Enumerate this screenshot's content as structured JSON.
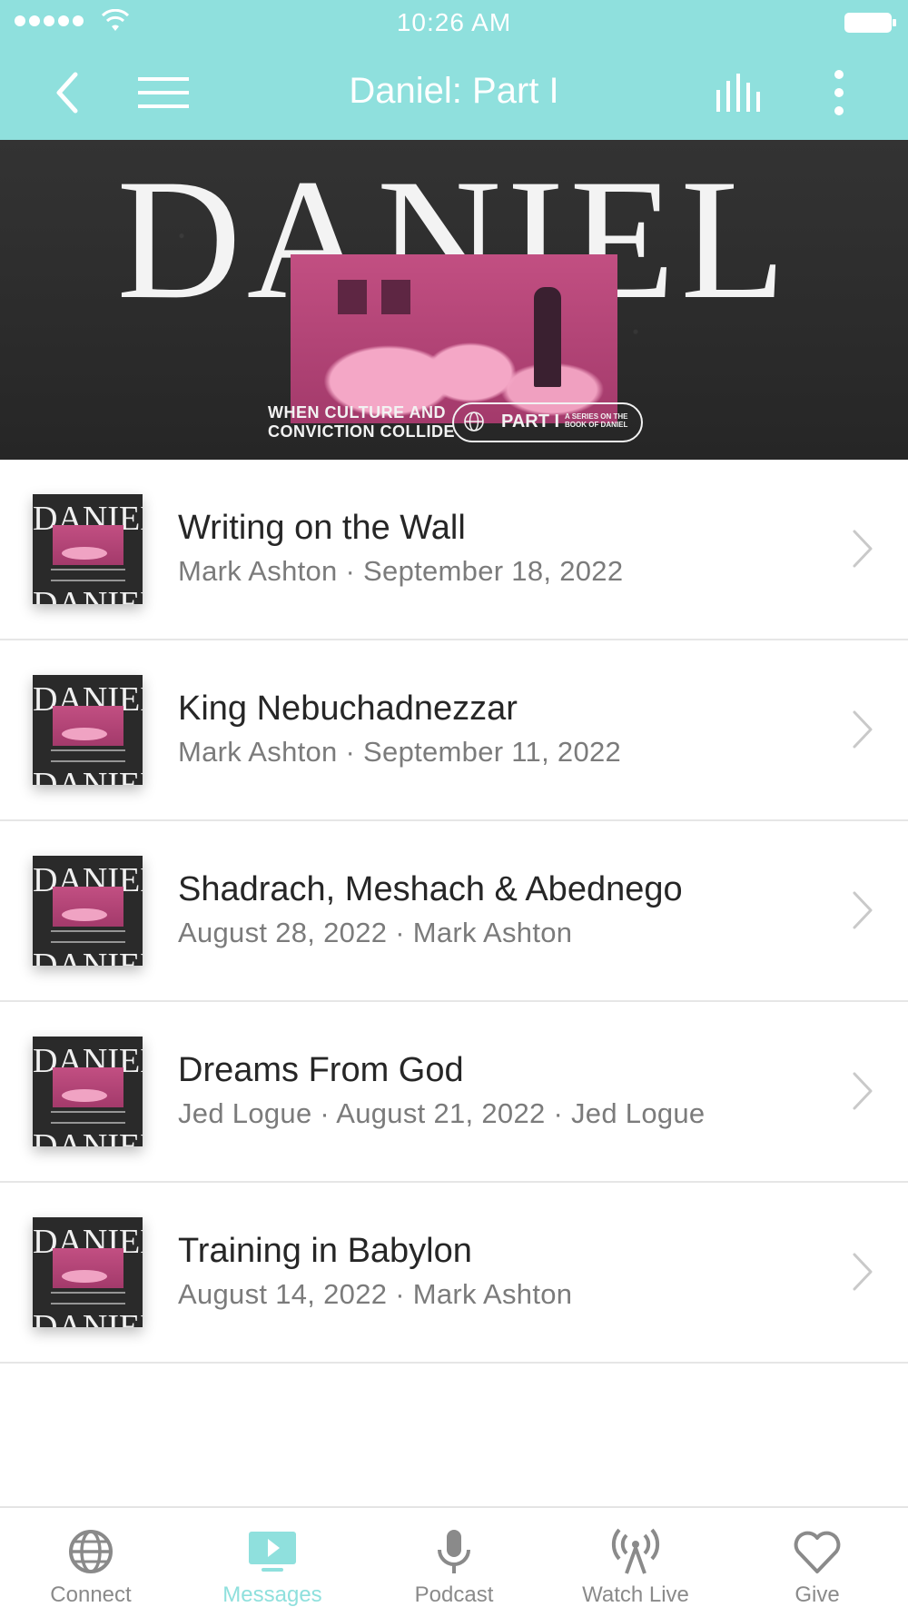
{
  "status_bar": {
    "time": "10:26 AM"
  },
  "navbar": {
    "title": "Daniel: Part I"
  },
  "banner": {
    "title": "DANIEL",
    "tagline_line1": "WHEN CULTURE AND",
    "tagline_line2": "CONVICTION COLLIDE",
    "part": "PART I",
    "series_line1": "A SERIES ON THE",
    "series_line2": "BOOK OF DANIEL"
  },
  "thumb_text": "DANIEL",
  "messages": [
    {
      "title": "Writing on the Wall",
      "subtitle": "Mark Ashton · September 18, 2022"
    },
    {
      "title": "King Nebuchadnezzar",
      "subtitle": "Mark Ashton · September 11, 2022"
    },
    {
      "title": "Shadrach, Meshach & Abednego",
      "subtitle": "August 28, 2022 · Mark Ashton"
    },
    {
      "title": "Dreams From God",
      "subtitle": "Jed Logue · August 21, 2022 · Jed Logue"
    },
    {
      "title": "Training in Babylon",
      "subtitle": "August 14, 2022 · Mark Ashton"
    }
  ],
  "tabs": [
    {
      "label": "Connect",
      "icon": "globe-icon",
      "active": false
    },
    {
      "label": "Messages",
      "icon": "play-screen-icon",
      "active": true
    },
    {
      "label": "Podcast",
      "icon": "microphone-icon",
      "active": false
    },
    {
      "label": "Watch Live",
      "icon": "broadcast-icon",
      "active": false
    },
    {
      "label": "Give",
      "icon": "heart-icon",
      "active": false
    }
  ],
  "colors": {
    "accent": "#8fe0dd",
    "tab_inactive": "#8a8a8a",
    "banner_bg": "#2b2b2b",
    "art_pink": "#c24f82"
  }
}
